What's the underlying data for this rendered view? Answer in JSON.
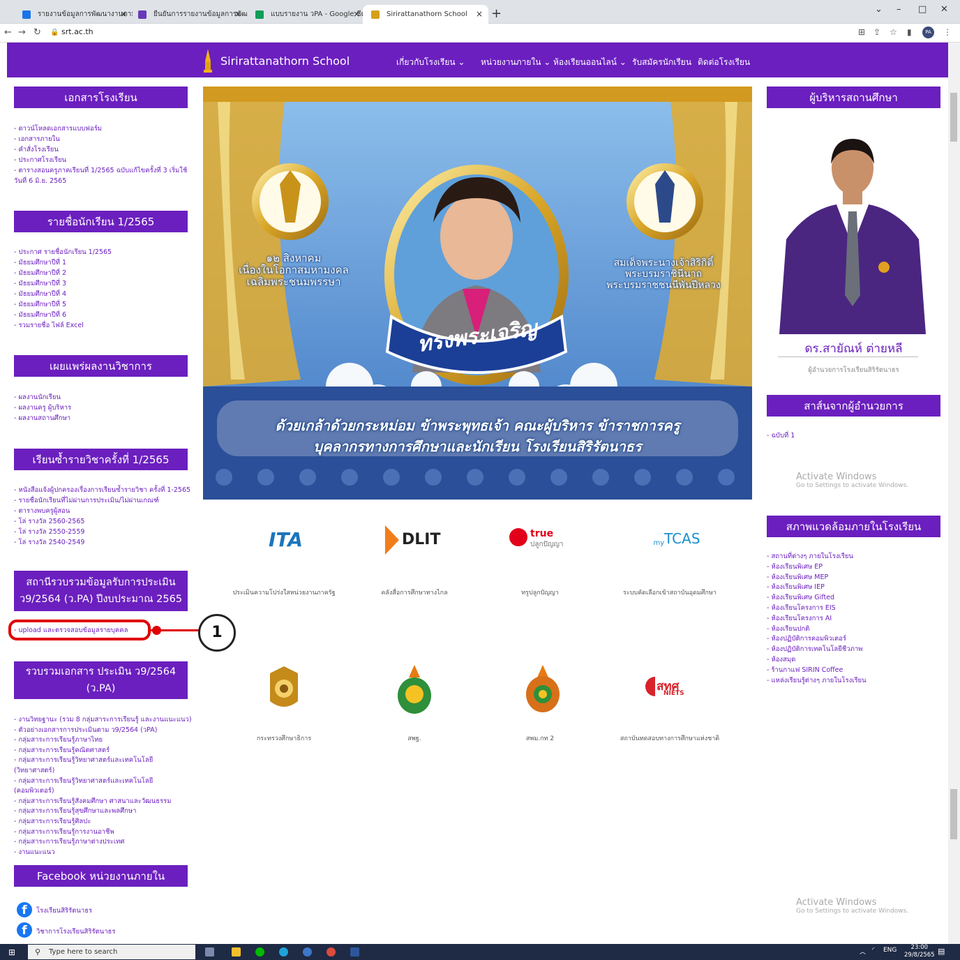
{
  "browser": {
    "tabs": [
      {
        "title": "รายงานข้อมูลการพัฒนางานตามข้อตก",
        "color": "#1a73e8"
      },
      {
        "title": "ยืนยันการรายงานข้อมูลการพัฒนางาน",
        "color": "#673ab7"
      },
      {
        "title": "แบบรายงาน วPA - Google ชีต",
        "color": "#0f9d58"
      },
      {
        "title": "Sirirattanathorn School",
        "color": "#d4a017"
      }
    ],
    "close_glyph": "×",
    "new_tab_glyph": "+",
    "url": "srt.ac.th",
    "profile": "PA"
  },
  "site": {
    "name": "Sirirattanathorn School",
    "menu": [
      "เกี่ยวกับโรงเรียน ⌄",
      "หน่วยงานภายใน ⌄",
      "ห้องเรียนออนไลน์ ⌄",
      "รับสมัครนักเรียน",
      "ติดต่อโรงเรียน"
    ]
  },
  "left": {
    "docs_title": "เอกสารโรงเรียน",
    "docs_links": [
      "- ดาวน์โหลดเอกสารแบบฟอร์ม",
      "- เอกสารภายใน",
      "- คำสั่งโรงเรียน",
      "- ประกาศโรงเรียน",
      "- ตารางสอนครูภาคเรียนที่ 1/2565 ฉบับแก้ไขครั้งที่ 3 เริ่มใช้วันที่ 6 มิ.ย. 2565"
    ],
    "students_title": "รายชื่อนักเรียน 1/2565",
    "students_links": [
      "- ประกาศ รายชื่อนักเรียน 1/2565",
      "- มัธยมศึกษาปีที่ 1",
      "- มัธยมศึกษาปีที่ 2",
      "- มัธยมศึกษาปีที่ 3",
      "- มัธยมศึกษาปีที่ 4",
      "- มัธยมศึกษาปีที่ 5",
      "- มัธยมศึกษาปีที่ 6",
      "- รวมรายชื่อ ไฟล์ Excel"
    ],
    "works_title": "เผยแพร่ผลงานวิชาการ",
    "works_links": [
      "- ผลงานนักเรียน",
      "- ผลงานครู ผู้บริหาร",
      "- ผลงานสถานศึกษา"
    ],
    "repeat_title": "เรียนซ้ำรายวิชาครั้งที่ 1/2565",
    "repeat_links": [
      "- หนังสือแจ้งผู้ปกครองเรื่องการเรียนซ้ำรายวิชา ครั้งที่ 1-2565",
      "- รายชื่อนักเรียนที่ไม่ผ่านการประเมิน/ไม่ผ่านเกณฑ์",
      "- ตารางพบครูผู้สอน",
      "- โล่ รางวัล 2560-2565",
      "- โล่ รางวัล 2550-2559",
      "- โล่ รางวัล 2540-2549"
    ],
    "pa_title": "สถานีรวบรวมข้อมูลรับการประเมิน ว9/2564 (ว.PA) ปีงบประมาณ 2565",
    "pa_link": "- upload และตรวจสอบข้อมูลรายบุคคล",
    "pa_docs_title": "รวบรวมเอกสาร ประเมิน ว9/2564 (ว.PA)",
    "pa_docs_links": [
      "- งานวิทยฐานะ (รวม 8 กลุ่มสาระการเรียนรู้ และงานแนะแนว)",
      "- ตัวอย่างเอกสารการประเมินตาม ว9/2564 (วPA)",
      "- กลุ่มสาระการเรียนรู้ภาษาไทย",
      "- กลุ่มสาระการเรียนรู้คณิตศาสตร์",
      "- กลุ่มสาระการเรียนรู้วิทยาศาสตร์และเทคโนโลยี (วิทยาศาสตร์)",
      "- กลุ่มสาระการเรียนรู้วิทยาศาสตร์และเทคโนโลยี (คอมพิวเตอร์)",
      "- กลุ่มสาระการเรียนรู้สังคมศึกษา ศาสนาและวัฒนธรรม",
      "- กลุ่มสาระการเรียนรู้สุขศึกษาและพลศึกษา",
      "- กลุ่มสาระการเรียนรู้ศิลปะ",
      "- กลุ่มสาระการเรียนรู้การงานอาชีพ",
      "- กลุ่มสาระการเรียนรู้ภาษาต่างประเทศ",
      "- งานแนะแนว"
    ],
    "fb_title": "Facebook หน่วยงานภายใน",
    "fb_links": [
      "โรงเรียนสิริรัตนาธร",
      "วิชาการโรงเรียนสิริรัตนาธร"
    ]
  },
  "banner": {
    "left_text": [
      "๑๒ สิงหาคม",
      "เนื่องในโอกาสมหามงคล",
      "เฉลิมพระชนมพรรษา"
    ],
    "right_text": [
      "สมเด็จพระนางเจ้าสิริกิติ์",
      "พระบรมราชินีนาถ",
      "พระบรมราชชนนีพันปีหลวง"
    ],
    "ribbon": "ทรงพระเจริญ",
    "line1": "ด้วยเกล้าด้วยกระหม่อม ข้าพระพุทธเจ้า คณะผู้บริหาร ข้าราชการครู",
    "line2": "บุคลากรทางการศึกษาและนักเรียน โรงเรียนสิริรัตนาธร"
  },
  "links": [
    {
      "logo": "ITA",
      "label": "ประเมินความโปร่งใสหน่วยงานภาครัฐ"
    },
    {
      "logo": "DLIT",
      "label": "คลังสื่อการศึกษาทางไกล"
    },
    {
      "logo": "true",
      "logo_sub": "ปลูกปัญญา",
      "label": "ทรูปลูกปัญญา"
    },
    {
      "logo": "TCAS",
      "logo_prefix": "my",
      "label": "ระบบคัดเลือกเข้าสถาบันอุดมศึกษา"
    },
    {
      "logo": "crest-moe",
      "label": "กระทรวงศึกษาธิการ"
    },
    {
      "logo": "crest-obec",
      "label": "สพฐ."
    },
    {
      "logo": "crest-sec",
      "label": "สพม.กท 2"
    },
    {
      "logo": "สทศ",
      "logo_sub": "NIETS",
      "label": "สถาบันทดสอบทางการศึกษาแห่งชาติ"
    }
  ],
  "right": {
    "admin_title": "ผู้บริหารสถานศึกษา",
    "admin_name": "ดร.สายัณห์ ต่ายหลี",
    "admin_role": "ผู้อำนวยการโรงเรียนสิริรัตนาธร",
    "msg_title": "สาส์นจากผู้อำนวยการ",
    "msg_links": [
      "- ฉบับที่ 1"
    ],
    "env_title": "สภาพแวดล้อมภายในโรงเรียน",
    "env_links": [
      "- สถานที่ต่างๆ ภายในโรงเรียน",
      "- ห้องเรียนพิเศษ EP",
      "- ห้องเรียนพิเศษ MEP",
      "- ห้องเรียนพิเศษ IEP",
      "- ห้องเรียนพิเศษ Gifted",
      "- ห้องเรียนโครงการ EIS",
      "- ห้องเรียนโครงการ AI",
      "- ห้องเรียนปกติ",
      "- ห้องปฏิบัติการคอมพิวเตอร์",
      "- ห้องปฏิบัติการเทคโนโลยีชีวภาพ",
      "- ห้องสมุด",
      "- ร้านกาแฟ SIRIN Coffee",
      "- แหล่งเรียนรู้ต่างๆ ภายในโรงเรียน"
    ]
  },
  "overlay": {
    "activate_title": "Activate Windows",
    "activate_sub": "Go to Settings to activate Windows.",
    "callout_number": "1"
  },
  "taskbar": {
    "search_placeholder": "Type here to search",
    "lang": "ENG",
    "time": "23:00",
    "date": "29/8/2565"
  }
}
